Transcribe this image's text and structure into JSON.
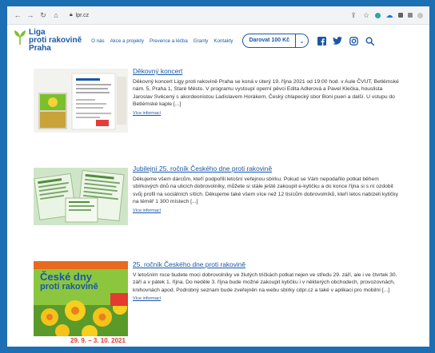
{
  "browser": {
    "url": "lpr.cz"
  },
  "site": {
    "logo_line1": "Liga",
    "logo_line2": "proti rakovině",
    "logo_line3": "Praha",
    "nav": [
      "O nás",
      "Akce a projekty",
      "Prevence a léčba",
      "Granty",
      "Kontakty"
    ],
    "donate_label": "Darovat 100 Kč",
    "social_icons": [
      "facebook-icon",
      "twitter-icon",
      "instagram-icon",
      "search-icon"
    ]
  },
  "colors": {
    "brand": "#1a57a6",
    "accent_green": "#7bbf2a",
    "page_background": "#1d6fb3"
  },
  "articles": [
    {
      "title": "Děkovný koncert",
      "text": "Děkovný koncert Ligy proti rakovině Praha se koná v úterý 19. října 2021 od 19:00 hod. v Aule ČVUT, Betlémské nám. 5, Praha 1, Staré Město. V programu vystoupí operní pěvci Edita Adlerová a Pavel Klečka, houslista Jaroslav Svěcený s akordeonistou Ladislavem Horákem, Český chlapecký sbor Boni pueri a další. U vstupu do Betlémské kaple [...]",
      "more": "Více informací"
    },
    {
      "title": "Jubilejní 25. ročník Českého dne proti rakovině",
      "text": "Děkujeme všem dárcům, kteří podpořili letošní veřejnou sbírku. Pokud se Vám nepodařilo potkat během sbírkových dnů na ulicích dobrovolníky, můžete si stále ještě zakoupit e-kytičku a do konce října si s ní ozdobit svůj profil na sociálních sítích. Děkujeme také všem více než 12 tisícům dobrovolníků, kteří letos nabízeli kytičky na téměř 1 300 místech [...]",
      "more": "Více informací"
    },
    {
      "title": "25. ročník Českého dne proti rakovině",
      "text": "V letošním roce budete moci dobrovolníky ve žlutých tričkách potkat nejen ve středu 29. září, ale i ve čtvrtek 30. září a v pátek 1. října. Do neděle 3. října bude možné zakoupit kytičku i v některých obchodech, provozovnách, knihovnách apod. Podrobný seznam bude zveřejněn na webu sbírky cdpr.cz a také v aplikaci pro mobilní [...]",
      "more": "Více informací",
      "poster_title1": "České dny",
      "poster_title2": "proti rakovině",
      "poster_date": "29. 9. – 3. 10. 2021"
    }
  ]
}
